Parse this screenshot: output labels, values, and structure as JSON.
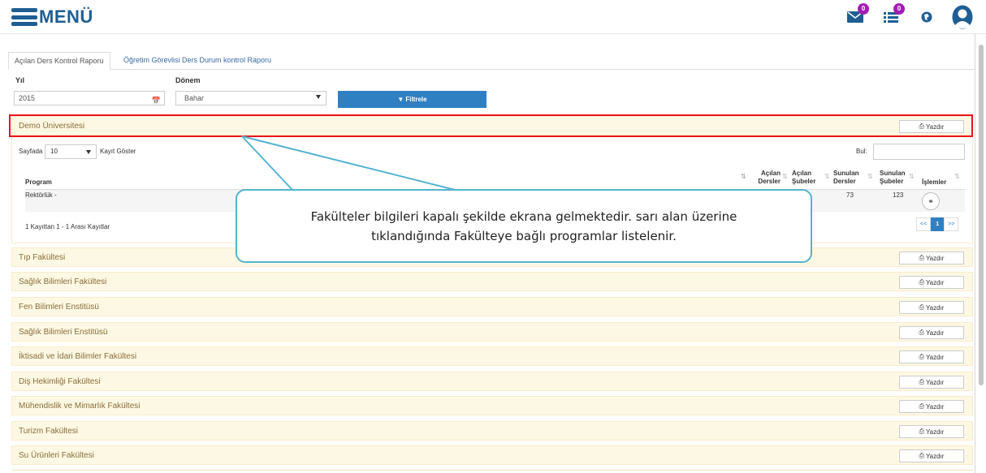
{
  "header": {
    "menu_label": "MENÜ",
    "icons": [
      {
        "name": "mail-icon",
        "badge": "0"
      },
      {
        "name": "tasks-icon",
        "badge": "0"
      },
      {
        "name": "globe-icon"
      },
      {
        "name": "user-avatar-icon"
      }
    ],
    "badge_color": "#a21db3",
    "brand_color": "#1f5e93"
  },
  "tabs": [
    {
      "label": "Açılan Ders Kontrol Raporu",
      "active": true
    },
    {
      "label": "Öğretim Görevlisi Ders Durum kontrol Raporu",
      "active": false
    }
  ],
  "filters": {
    "year_label": "Yıl",
    "year_value": "2015",
    "term_label": "Dönem",
    "term_value": "Bahar",
    "filter_button": "Filtrele"
  },
  "print_label": "Yazdır",
  "expanded_panel": {
    "title": "Demo Üniversitesi",
    "length_label": "Sayfada",
    "length_value": "10",
    "length_suffix": "Kayıt Göster",
    "search_label": "Bul:",
    "columns": [
      "Program",
      "Açılan Dersler",
      "Açılan Şubeler",
      "Sunulan Dersler",
      "Sunulan Şubeler",
      "İşlemler"
    ],
    "rows": [
      {
        "program": "Rektörlük -",
        "sunulan_dersler": "73",
        "sunulan_subeler": "123"
      }
    ],
    "info": "1 Kayıttan 1 - 1 Arası Kayıtlar",
    "pager": [
      "<<",
      "1",
      ">>"
    ]
  },
  "faculties": [
    "Tıp Fakültesi",
    "Sağlık Bilimleri Fakültesi",
    "Fen Bilimleri Enstitüsü",
    "Sağlık Bilimleri Enstitüsü",
    "İktisadi ve İdari Bilimler Fakültesi",
    "Diş Hekimliği Fakültesi",
    "Mühendislik ve Mimarlık Fakültesi",
    "Turizm Fakültesi",
    "Su Ürünleri Fakültesi"
  ],
  "callout": {
    "line1": "Fakülteler bilgileri kapalı şekilde ekrana gelmektedir. sarı alan üzerine",
    "line2": "tıklandığında Fakülteye bağlı programlar listelenir."
  },
  "colors": {
    "panel_bg": "#fcf8e3",
    "highlight": "#e8141d",
    "callout_border": "#55b3cf",
    "primary": "#2f80c3"
  }
}
